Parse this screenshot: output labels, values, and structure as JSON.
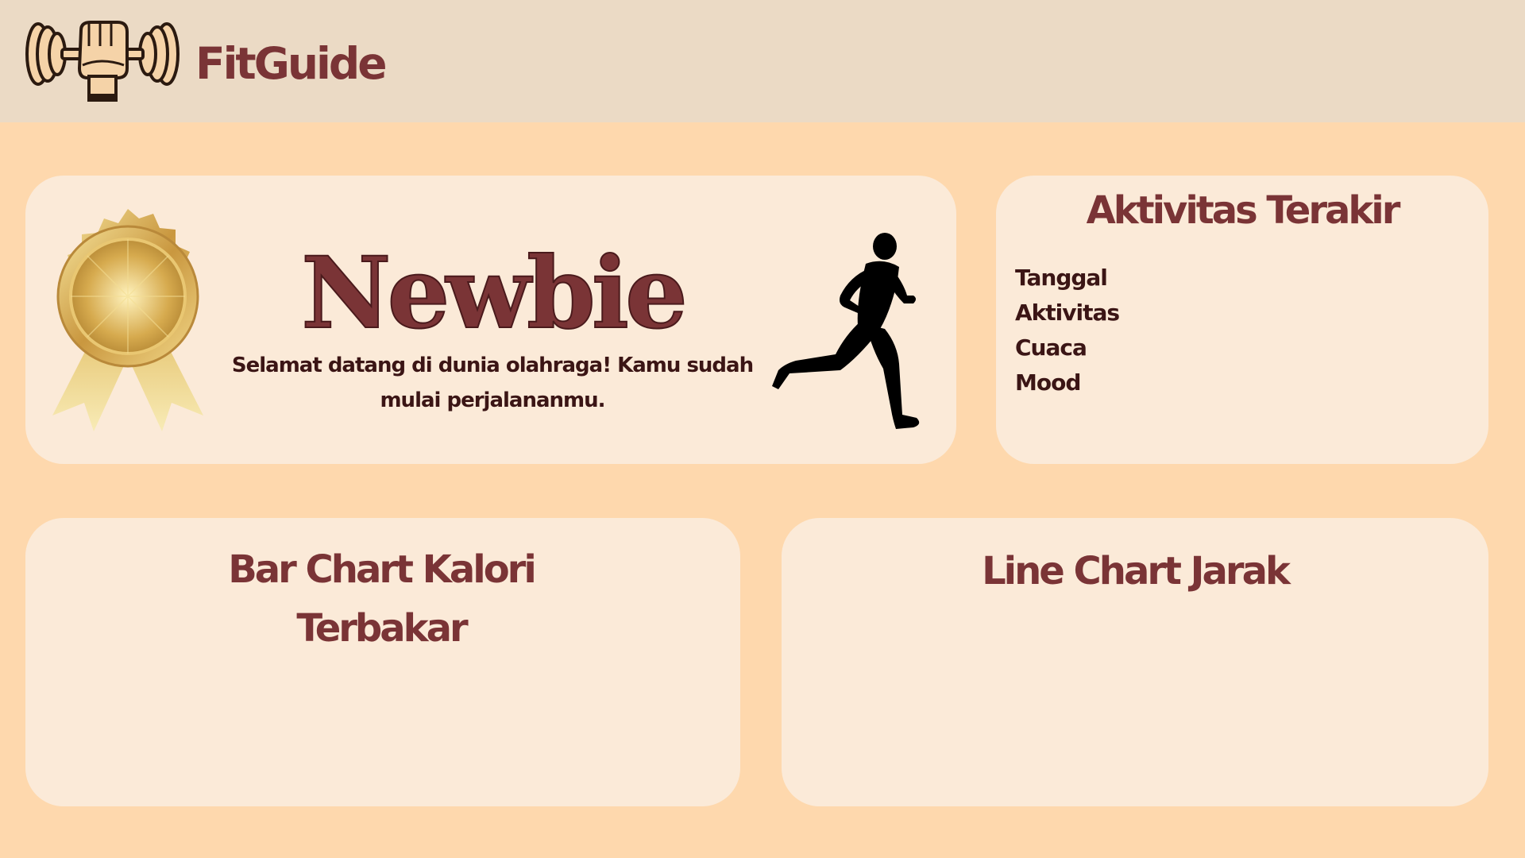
{
  "header": {
    "brand": "FitGuide",
    "logo_icon": "dumbbell-fist-icon"
  },
  "hero": {
    "level": "Newbie",
    "description": "Selamat datang di dunia olahraga! Kamu sudah mulai perjalananmu.",
    "medal_icon": "gold-medal-icon",
    "runner_icon": "runner-silhouette-icon"
  },
  "recent_activity": {
    "title": "Aktivitas Terakir",
    "fields": [
      "Tanggal",
      "Aktivitas",
      "Cuaca",
      "Mood"
    ]
  },
  "bar_chart": {
    "title": "Bar Chart Kalori Terbakar"
  },
  "line_chart": {
    "title": "Line Chart Jarak"
  },
  "colors": {
    "background": "#FED8AD",
    "topbar": "#EBDAC5",
    "card": "#FBEAD8",
    "title": "#7A3436",
    "text": "#3B1515",
    "gold": "#D9B45A"
  }
}
